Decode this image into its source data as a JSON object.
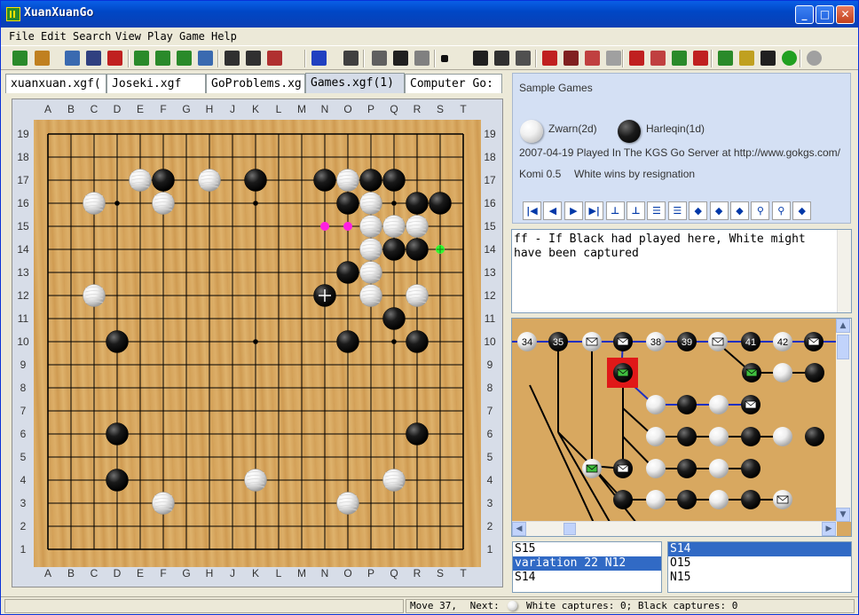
{
  "app": {
    "title": "XuanXuanGo"
  },
  "window_controls": {
    "minimize": "_",
    "maximize": "□",
    "close": "✕"
  },
  "menu": [
    "File",
    "Edit",
    "Search",
    "View",
    "Play",
    "Game",
    "Help"
  ],
  "toolbar": {
    "icons": [
      "new-game-icon",
      "open-icon",
      "search-icon",
      "save-icon",
      "close-icon",
      "board-setup-icon",
      "board-setup2-icon",
      "board-setup3-icon",
      "print-icon",
      "grid-icon",
      "move-number-icon",
      "coordinates-icon",
      "rotate-icon",
      "flip-icon",
      "edit-icon",
      "info-icon",
      "eraser-icon",
      "black-stone-icon",
      "add-stone-icon",
      "crosshair-icon",
      "hand-icon",
      "mark-icon",
      "triangle-mark-icon",
      "label-icon",
      "move-up-icon",
      "move-down-icon",
      "note-icon",
      "check-icon",
      "red-bookmark-icon",
      "green-bookmark-icon",
      "yellow-bookmark-icon",
      "go-logo-icon",
      "status-green-icon",
      "status-gray-icon"
    ]
  },
  "tabs": [
    "xuanxuan.xgf(",
    "Joseki.xgf",
    "GoProblems.xg",
    "Games.xgf(1)",
    "Computer Go:"
  ],
  "active_tab": 3,
  "board": {
    "size": 19,
    "columns": [
      "A",
      "B",
      "C",
      "D",
      "E",
      "F",
      "G",
      "H",
      "J",
      "K",
      "L",
      "M",
      "N",
      "O",
      "P",
      "Q",
      "R",
      "S",
      "T"
    ],
    "rows": [
      "19",
      "18",
      "17",
      "16",
      "15",
      "14",
      "13",
      "12",
      "11",
      "10",
      "9",
      "8",
      "7",
      "6",
      "5",
      "4",
      "3",
      "2",
      "1"
    ],
    "black_stones": [
      "F17",
      "K17",
      "N17",
      "P17",
      "Q17",
      "O16",
      "R16",
      "S16",
      "Q14",
      "R14",
      "O13",
      "N12",
      "Q11",
      "D10",
      "O10",
      "R10",
      "D6",
      "R6",
      "D4"
    ],
    "white_stones": [
      "E17",
      "H17",
      "O17",
      "C16",
      "F16",
      "P16",
      "P15",
      "Q15",
      "R15",
      "P14",
      "P13",
      "P12",
      "R12",
      "C12",
      "Q4",
      "F3",
      "K4",
      "O3"
    ],
    "markers": {
      "magenta": [
        "N15",
        "O15"
      ],
      "green_cross": [
        "S14"
      ],
      "current": "N12"
    },
    "hoshi": [
      "D16",
      "K16",
      "Q16",
      "D10",
      "K10",
      "Q10",
      "D4",
      "K4",
      "Q4"
    ]
  },
  "game_info": {
    "title": "Sample Games",
    "white_player": "Zwarn(2d)",
    "black_player": "Harleqin(1d)",
    "date_line": "2007-04-19 Played In The KGS Go Server at http://www.gokgs.com/",
    "komi": "Komi 0.5",
    "result": "White wins by resignation"
  },
  "nav_buttons": [
    "|◀",
    "◀",
    "▶",
    "▶|",
    "⊥",
    "⊥",
    "☰",
    "☰",
    "◆",
    "◆",
    "◆",
    "⚲",
    "⚲",
    "◆"
  ],
  "comment": "ff - If Black had played here, White might have been captured",
  "tree": {
    "main_line": [
      "34",
      "35",
      "",
      "",
      "38",
      "39",
      "",
      "41",
      "42",
      ""
    ]
  },
  "lists": {
    "left": [
      "S15",
      "variation 22 N12",
      "S14"
    ],
    "left_selected": 1,
    "right": [
      "S14",
      "O15",
      "N15"
    ],
    "right_selected": 0
  },
  "status": {
    "move": "Move 37,",
    "next_label": "Next:",
    "captures": "White captures: 0; Black captures: 0"
  }
}
